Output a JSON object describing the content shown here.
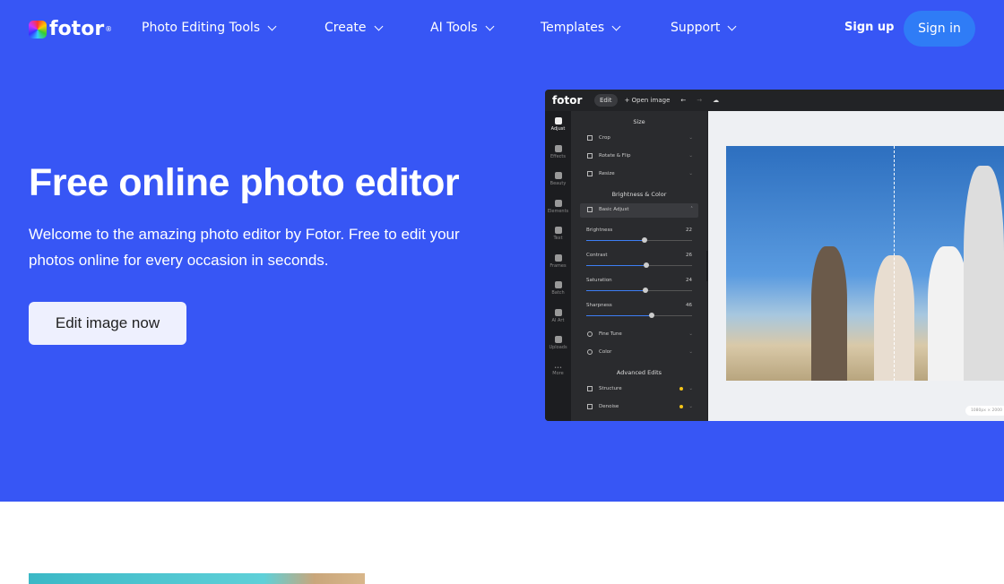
{
  "nav": {
    "brand": "fotor",
    "items": [
      {
        "label": "Photo Editing Tools"
      },
      {
        "label": "Create"
      },
      {
        "label": "AI Tools"
      },
      {
        "label": "Templates"
      },
      {
        "label": "Support"
      }
    ],
    "sign_up": "Sign up",
    "sign_in": "Sign in"
  },
  "hero": {
    "title": "Free online photo editor",
    "subtitle": "Welcome to the amazing photo editor by Fotor. Free to edit your photos online for every occasion in seconds.",
    "cta": "Edit image now",
    "bg_color": "#3756f5"
  },
  "editor": {
    "brand": "fotor",
    "edit_menu": "Edit",
    "open_image": "+ Open image",
    "rail": [
      "Adjust",
      "Effects",
      "Beauty",
      "Elements",
      "Text",
      "Frames",
      "Batch",
      "AI Art",
      "Uploads",
      "More"
    ],
    "size_heading": "Size",
    "size_items": [
      "Crop",
      "Rotate & Flip",
      "Resize"
    ],
    "bc_heading": "Brightness & Color",
    "basic_adjust": "Basic Adjust",
    "sliders": [
      {
        "label": "Brightness",
        "value": 22
      },
      {
        "label": "Contrast",
        "value": 26
      },
      {
        "label": "Saturation",
        "value": 24
      },
      {
        "label": "Sharpness",
        "value": 46
      }
    ],
    "bc_items": [
      "Fine Tune",
      "Color"
    ],
    "adv_heading": "Advanced Edits",
    "adv_items": [
      "Structure",
      "Denoise"
    ],
    "dimensions": "1080px × 2000"
  }
}
